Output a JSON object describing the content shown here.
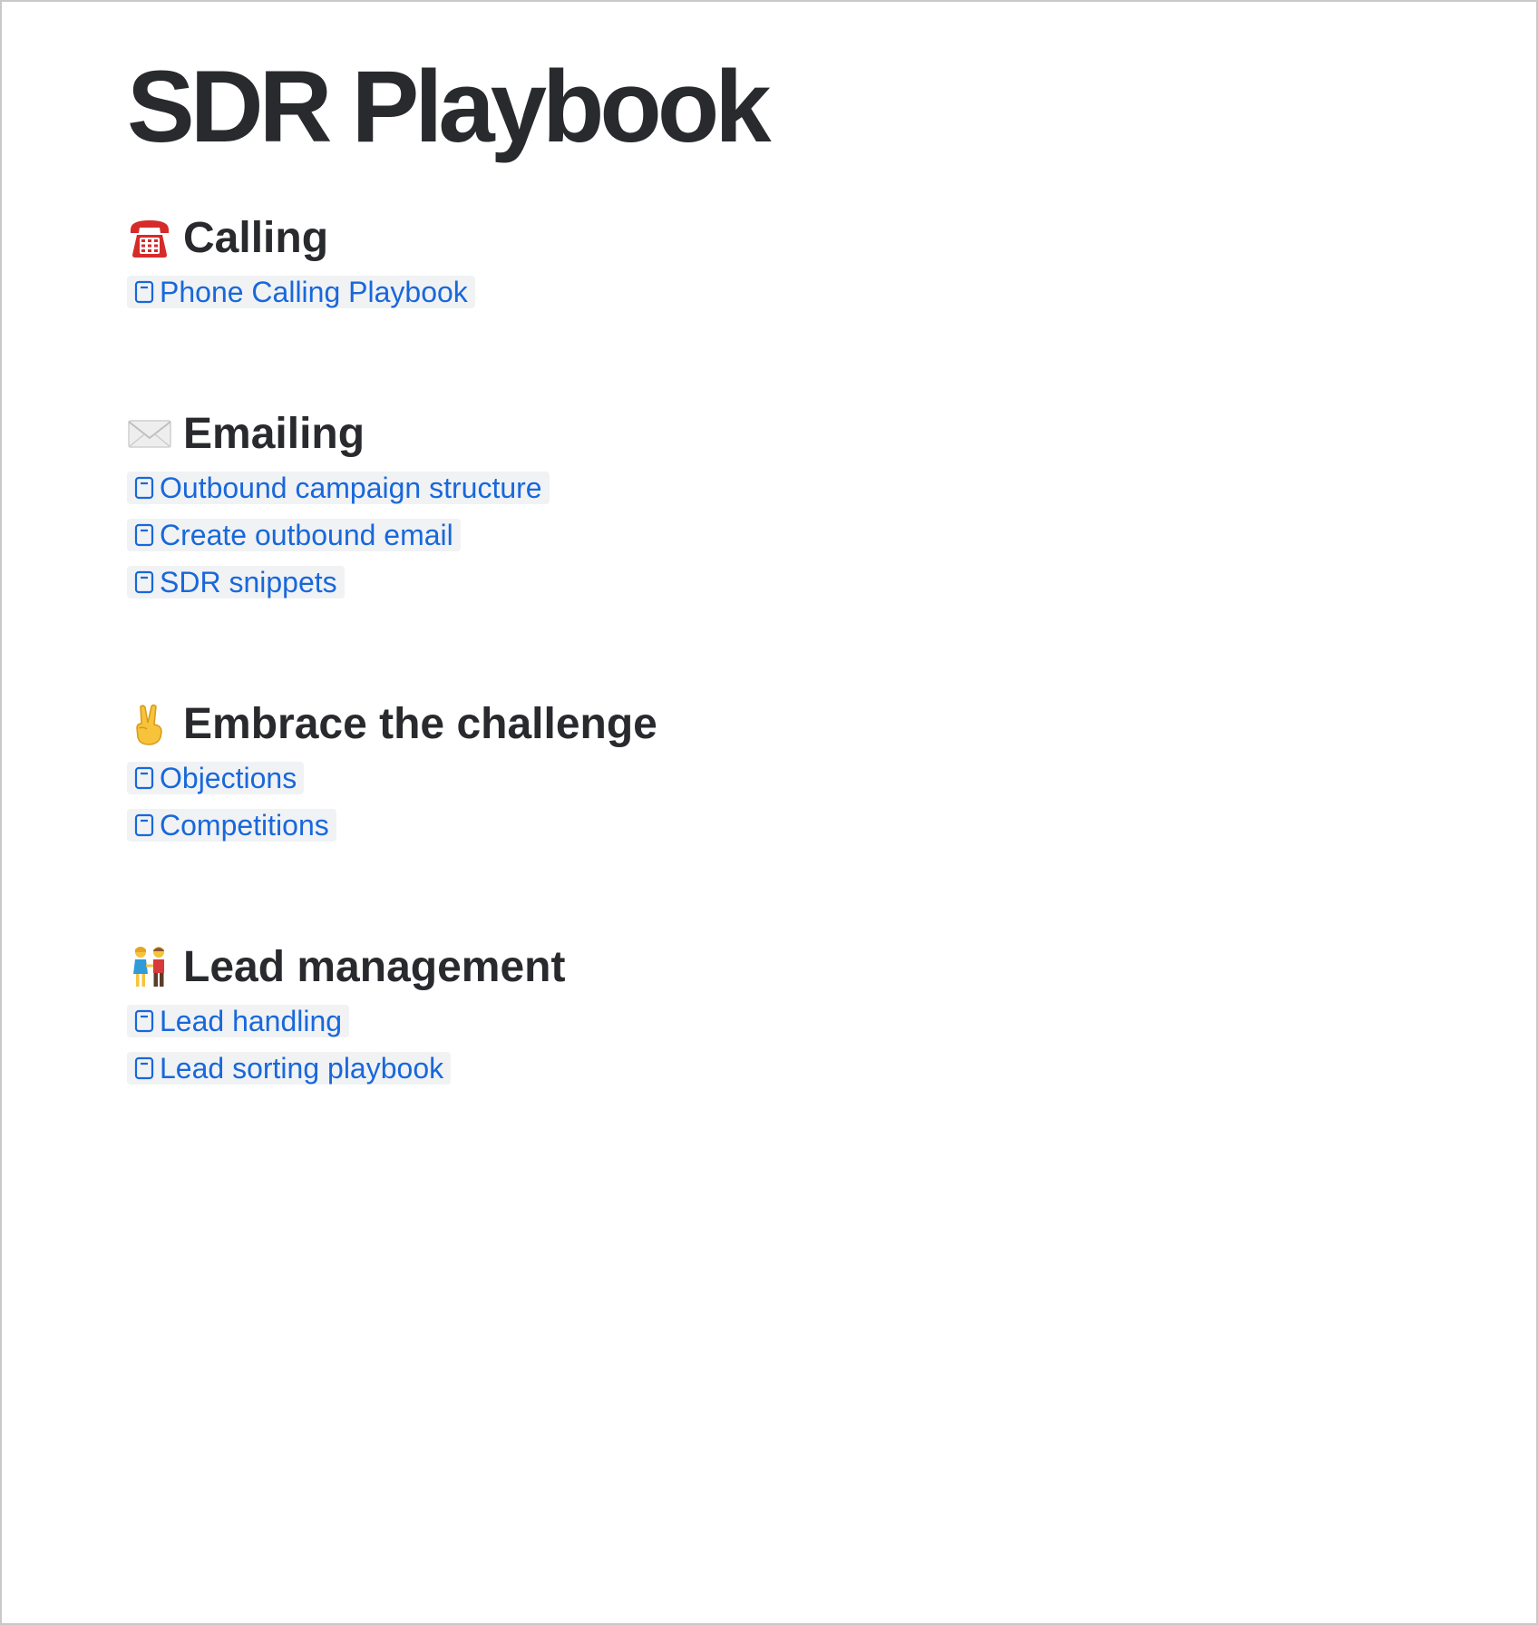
{
  "page": {
    "title": "SDR Playbook"
  },
  "colors": {
    "heading": "#292a2e",
    "link": "#1868db",
    "link_background": "#f1f2f4",
    "border": "#c9c9c9"
  },
  "sections": [
    {
      "icon": "telephone-icon",
      "heading": "Calling",
      "links": [
        {
          "icon": "page-icon",
          "label": "Phone Calling Playbook"
        }
      ]
    },
    {
      "icon": "envelope-icon",
      "heading": "Emailing",
      "links": [
        {
          "icon": "page-icon",
          "label": "Outbound campaign structure"
        },
        {
          "icon": "page-icon",
          "label": "Create outbound email"
        },
        {
          "icon": "page-icon",
          "label": "SDR snippets"
        }
      ]
    },
    {
      "icon": "victory-hand-icon",
      "heading": "Embrace the challenge",
      "links": [
        {
          "icon": "page-icon",
          "label": "Objections"
        },
        {
          "icon": "page-icon",
          "label": "Competitions"
        }
      ]
    },
    {
      "icon": "couple-holding-hands-icon",
      "heading": "Lead management",
      "links": [
        {
          "icon": "page-icon",
          "label": "Lead handling"
        },
        {
          "icon": "page-icon",
          "label": "Lead sorting playbook"
        }
      ]
    }
  ]
}
